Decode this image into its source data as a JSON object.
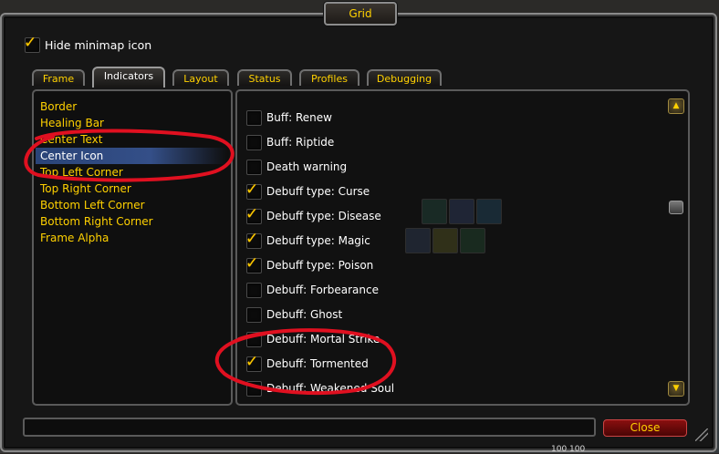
{
  "window": {
    "title": "Grid"
  },
  "options": {
    "hide_minimap_label": "Hide minimap icon",
    "hide_minimap_checked": true
  },
  "tabs": [
    {
      "label": "Frame",
      "active": false
    },
    {
      "label": "Indicators",
      "active": true
    },
    {
      "label": "Layout",
      "active": false
    },
    {
      "label": "Status",
      "active": false
    },
    {
      "label": "Profiles",
      "active": false
    },
    {
      "label": "Debugging",
      "active": false
    }
  ],
  "indicators": [
    {
      "label": "Border",
      "selected": false
    },
    {
      "label": "Healing Bar",
      "selected": false
    },
    {
      "label": "Center Text",
      "selected": false
    },
    {
      "label": "Center Icon",
      "selected": true
    },
    {
      "label": "Top Left Corner",
      "selected": false
    },
    {
      "label": "Top Right Corner",
      "selected": false
    },
    {
      "label": "Bottom Left Corner",
      "selected": false
    },
    {
      "label": "Bottom Right Corner",
      "selected": false
    },
    {
      "label": "Frame Alpha",
      "selected": false
    }
  ],
  "status_options": [
    {
      "label": "Buff: Renew",
      "checked": false
    },
    {
      "label": "Buff: Riptide",
      "checked": false
    },
    {
      "label": "Death warning",
      "checked": false
    },
    {
      "label": "Debuff type: Curse",
      "checked": true
    },
    {
      "label": "Debuff type: Disease",
      "checked": true
    },
    {
      "label": "Debuff type: Magic",
      "checked": true
    },
    {
      "label": "Debuff type: Poison",
      "checked": true
    },
    {
      "label": "Debuff: Forbearance",
      "checked": false
    },
    {
      "label": "Debuff: Ghost",
      "checked": false
    },
    {
      "label": "Debuff: Mortal Strike",
      "checked": false
    },
    {
      "label": "Debuff: Tormented",
      "checked": true
    },
    {
      "label": "Debuff: Weakened Soul",
      "checked": false
    }
  ],
  "scrollbar": {
    "up_icon": "arrow-up-icon",
    "down_icon": "arrow-down-icon"
  },
  "footer": {
    "close_label": "Close",
    "status_text": "100 100"
  },
  "colors": {
    "accent_gold": "#ffd100",
    "check_gold": "#ffcc00",
    "selection_blue": "#2a4478",
    "close_red": "#8a0f0f",
    "annotation_red": "#e01020"
  }
}
